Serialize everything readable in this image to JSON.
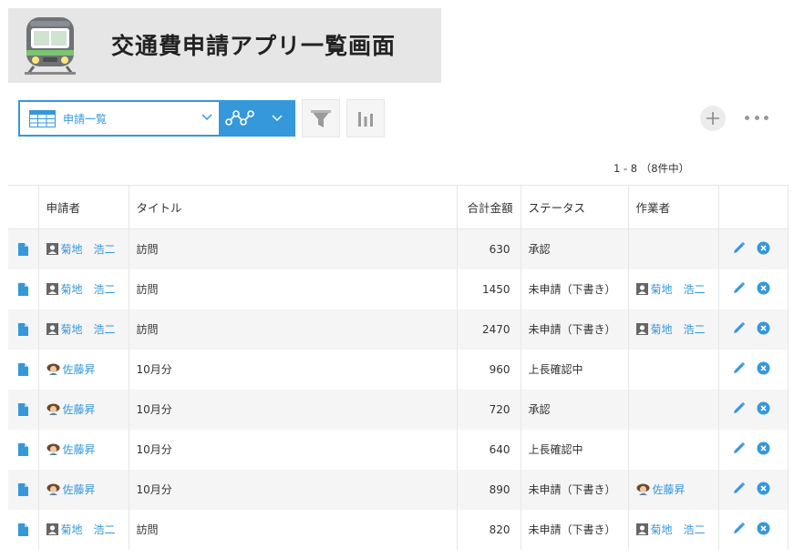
{
  "app": {
    "title": "交通費申請アプリ一覧画面",
    "icon": "train-icon"
  },
  "toolbar": {
    "view_label": "申請一覧",
    "view_icon": "table-grid-icon",
    "graph_icon": "line-graph-icon",
    "filter_icon": "funnel-icon",
    "chart_icon": "bar-chart-icon",
    "add_icon": "plus-icon",
    "more_icon": "ellipsis-icon"
  },
  "pager": {
    "text": "1 - 8 （8件中）"
  },
  "table": {
    "columns": [
      "申請者",
      "タイトル",
      "合計金額",
      "ステータス",
      "作業者"
    ],
    "rows": [
      {
        "applicant": "菊地　浩二",
        "applicant_avatar": "silhouette",
        "title": "訪問",
        "amount": "630",
        "status": "承認",
        "worker": "",
        "worker_avatar": ""
      },
      {
        "applicant": "菊地　浩二",
        "applicant_avatar": "silhouette",
        "title": "訪問",
        "amount": "1450",
        "status": "未申請（下書き）",
        "worker": "菊地　浩二",
        "worker_avatar": "silhouette"
      },
      {
        "applicant": "菊地　浩二",
        "applicant_avatar": "silhouette",
        "title": "訪問",
        "amount": "2470",
        "status": "未申請（下書き）",
        "worker": "菊地　浩二",
        "worker_avatar": "silhouette"
      },
      {
        "applicant": "佐藤昇",
        "applicant_avatar": "photo",
        "title": "10月分",
        "amount": "960",
        "status": "上長確認中",
        "worker": "",
        "worker_avatar": ""
      },
      {
        "applicant": "佐藤昇",
        "applicant_avatar": "photo",
        "title": "10月分",
        "amount": "720",
        "status": "承認",
        "worker": "",
        "worker_avatar": ""
      },
      {
        "applicant": "佐藤昇",
        "applicant_avatar": "photo",
        "title": "10月分",
        "amount": "640",
        "status": "上長確認中",
        "worker": "",
        "worker_avatar": ""
      },
      {
        "applicant": "佐藤昇",
        "applicant_avatar": "photo",
        "title": "10月分",
        "amount": "890",
        "status": "未申請（下書き）",
        "worker": "佐藤昇",
        "worker_avatar": "photo"
      },
      {
        "applicant": "菊地　浩二",
        "applicant_avatar": "silhouette",
        "title": "訪問",
        "amount": "820",
        "status": "未申請（下書き）",
        "worker": "菊地　浩二",
        "worker_avatar": "silhouette"
      }
    ],
    "row_icons": {
      "detail": "document-icon",
      "edit": "pencil-icon",
      "delete": "close-circle-icon"
    }
  },
  "colors": {
    "accent": "#3498db",
    "banner_bg": "#e6e6e6",
    "stripe": "#f5f5f5",
    "border": "#e3e7e8"
  }
}
